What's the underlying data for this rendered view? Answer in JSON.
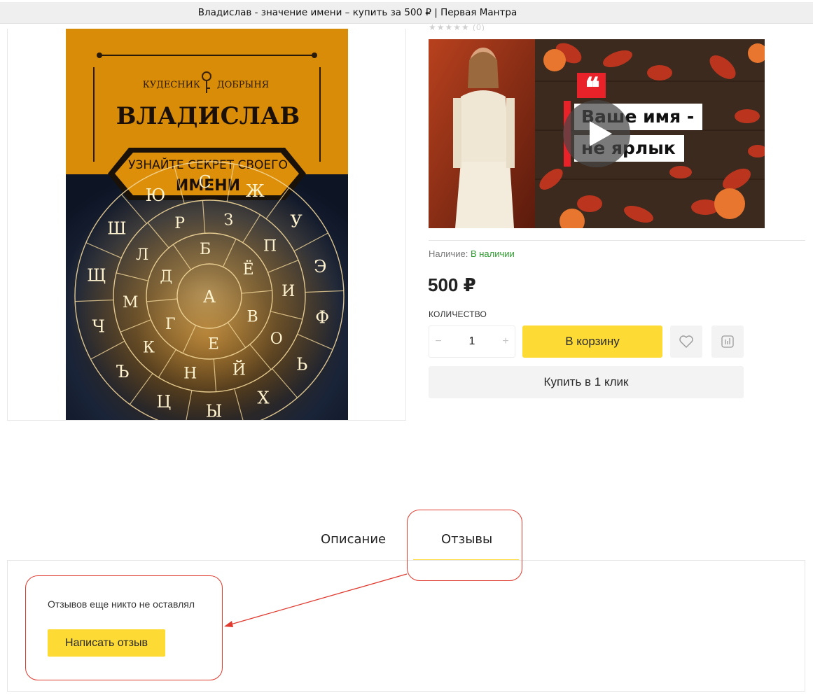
{
  "window": {
    "title": "Владислав - значение имени – купить за 500 ₽ | Первая Мантра"
  },
  "product": {
    "cover": {
      "publisher_left": "КУДЕСНИК",
      "publisher_right": "ДОБРЫНЯ",
      "name": "ВЛАДИСЛАВ",
      "banner_line1": "УЗНАЙТЕ СЕКРЕТ СВОЕГО",
      "banner_line2": "ИМЕНИ",
      "wheel_letters": {
        "outer": [
          "Ю",
          "С",
          "Ж",
          "У",
          "Э",
          "Ф",
          "Ь",
          "Х",
          "Ы",
          "Ц",
          "Ъ",
          "Ч",
          "Щ",
          "Ш"
        ],
        "middle": [
          "Р",
          "З",
          "П",
          "И",
          "О",
          "Й",
          "Н",
          "К",
          "М",
          "Л"
        ],
        "inner": [
          "Б",
          "Ё",
          "В",
          "Е",
          "Г",
          "Д"
        ],
        "center": "А"
      }
    },
    "rating_text": "★★★★★ (0)",
    "video": {
      "caption_line1": "Ваше имя -",
      "caption_line2": "не ярлык",
      "quote_mark": "❝"
    },
    "availability": {
      "label": "Наличие:",
      "value": "В наличии"
    },
    "price": "500 ₽",
    "quantity": {
      "label": "КОЛИЧЕСТВО",
      "value": "1",
      "minus": "−",
      "plus": "+"
    },
    "buttons": {
      "cart": "В корзину",
      "one_click": "Купить в 1 клик"
    }
  },
  "tabs": [
    {
      "label": "Описание"
    },
    {
      "label": "Отзывы",
      "active": true
    }
  ],
  "reviews": {
    "empty_text": "Отзывов еще никто не оставлял",
    "write_button": "Написать отзыв"
  },
  "colors": {
    "accent_yellow": "#fddb34",
    "annotation_red": "#e0392e",
    "in_stock_green": "#2e9b2e"
  }
}
